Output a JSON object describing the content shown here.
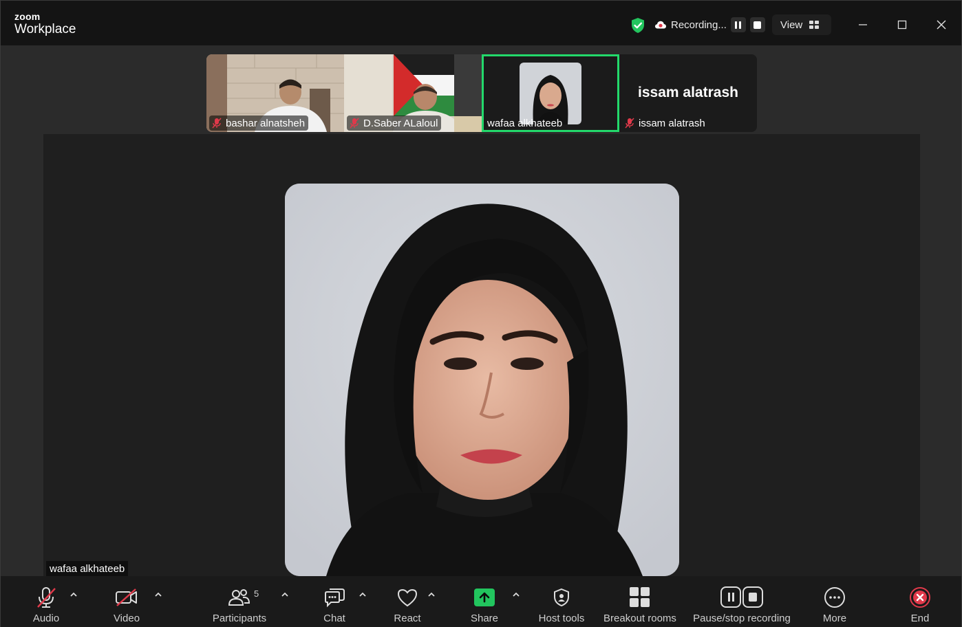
{
  "app": {
    "brand_top": "zoom",
    "brand_bottom": "Workplace"
  },
  "header": {
    "recording_text": "Recording...",
    "view_label": "View"
  },
  "participants_strip": [
    {
      "name": "bashar alnatsheh",
      "muted": true
    },
    {
      "name": "D.Saber ALaloul",
      "muted": true
    },
    {
      "name": "wafaa alkhateeb",
      "muted": false,
      "active": true
    },
    {
      "name": "issam alatrash",
      "muted": true,
      "display_name": "issam alatrash"
    }
  ],
  "main": {
    "speaker_name": "wafaa alkhateeb"
  },
  "toolbar": {
    "audio": "Audio",
    "video": "Video",
    "participants": "Participants",
    "participants_count": "5",
    "chat": "Chat",
    "react": "React",
    "share": "Share",
    "host_tools": "Host tools",
    "breakout_rooms": "Breakout rooms",
    "pause_stop_recording": "Pause/stop recording",
    "more": "More",
    "end": "End"
  },
  "colors": {
    "accent_green": "#23d96b",
    "muted_red": "#e0394a",
    "share_green": "#22c55e"
  }
}
